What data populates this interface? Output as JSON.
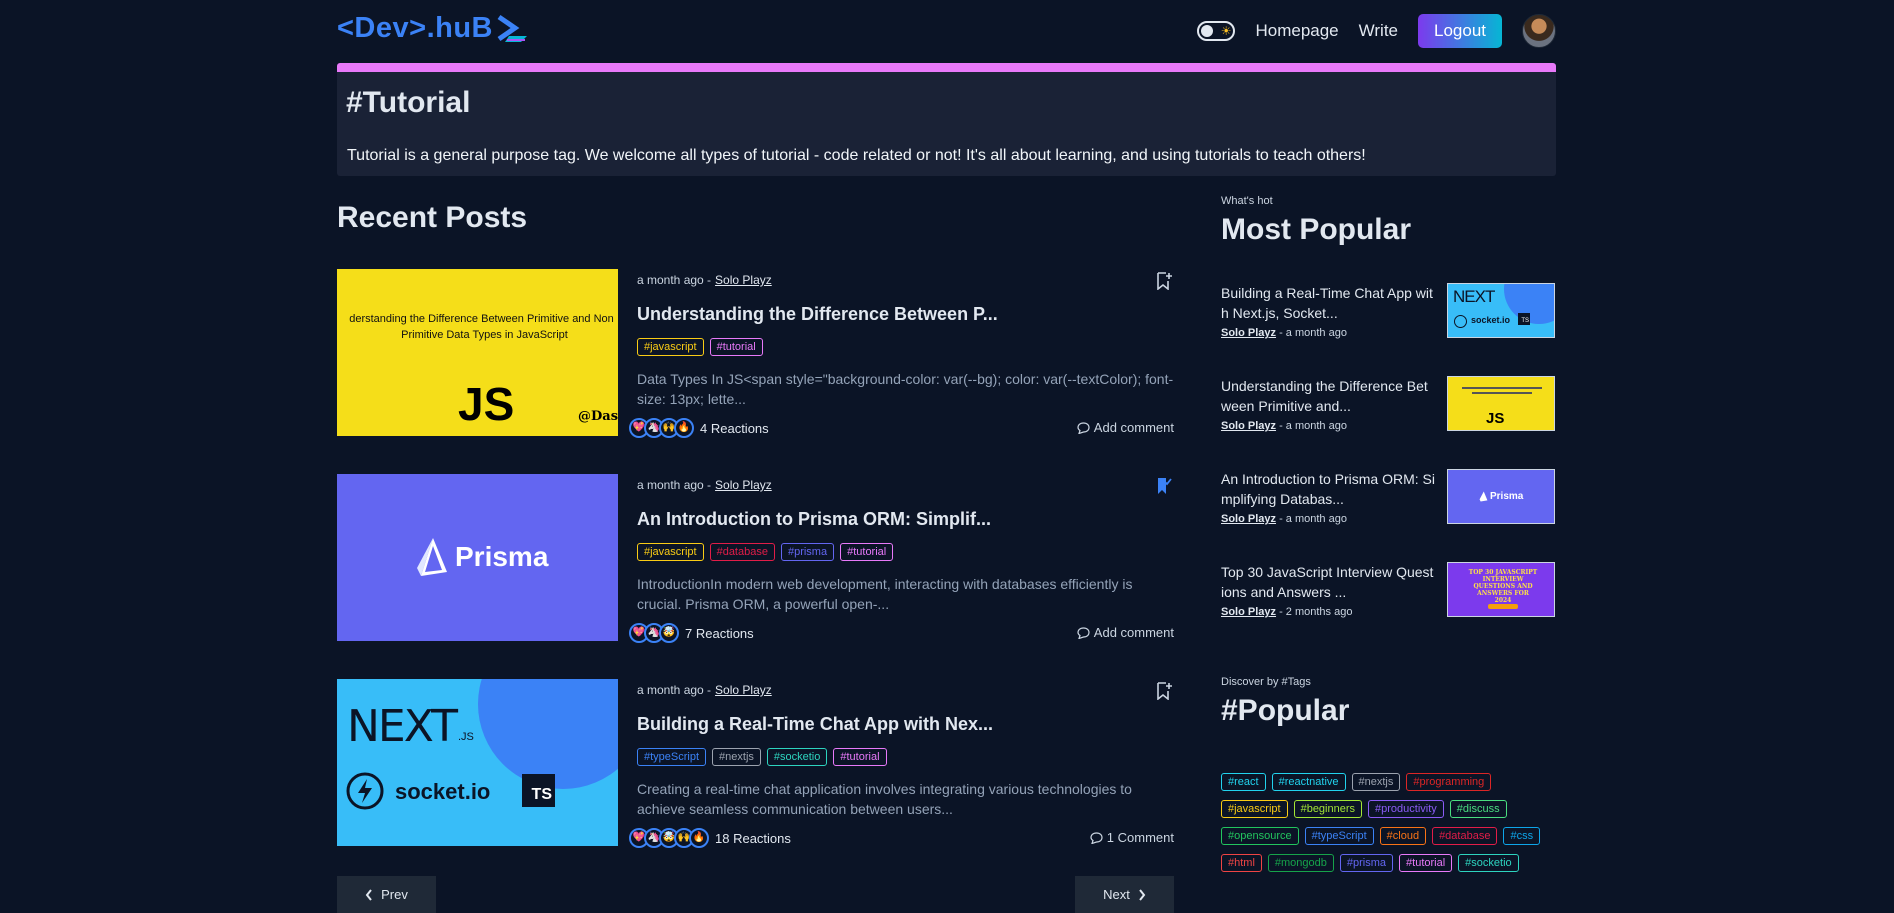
{
  "header": {
    "logo": "<Dev>.huB",
    "nav_home": "Homepage",
    "nav_write": "Write",
    "logout": "Logout"
  },
  "banner": {
    "title": "#Tutorial",
    "description": "Tutorial is a general purpose tag. We welcome all types of tutorial - code related or not! It's all about learning, and using tutorials to teach others!"
  },
  "recent": {
    "title": "Recent Posts",
    "posts": [
      {
        "time": "a month ago -",
        "author": "Solo Playz",
        "title": "Understanding the Difference Between P...",
        "tags": [
          "#javascript",
          "#tutorial"
        ],
        "excerpt": "Data Types In JS<span style=\"background-color: var(--bg); color: var(--textColor); font-size: 13px; lette...",
        "reactions": "4 Reactions",
        "comment": "Add comment",
        "bookmarked": false,
        "thumb": {
          "line1": "derstanding the Difference Between Primitive and Non",
          "line2": "Primitive Data Types in JavaScript",
          "big": "JS",
          "corner": "@Dasl"
        }
      },
      {
        "time": "a month ago -",
        "author": "Solo Playz",
        "title": "An Introduction to Prisma ORM: Simplif...",
        "tags": [
          "#javascript",
          "#database",
          "#prisma",
          "#tutorial"
        ],
        "excerpt": "IntroductionIn modern web development, interacting with databases efficiently is crucial. Prisma ORM, a powerful open-...",
        "reactions": "7 Reactions",
        "comment": "Add comment",
        "bookmarked": true,
        "thumb": {
          "brand": "Prisma"
        }
      },
      {
        "time": "a month ago -",
        "author": "Solo Playz",
        "title": "Building a Real-Time Chat App with Nex...",
        "tags": [
          "#typeScript",
          "#nextjs",
          "#socketio",
          "#tutorial"
        ],
        "excerpt": "Creating a real-time chat application involves integrating various technologies to achieve seamless communication between users...",
        "reactions": "18 Reactions",
        "comment": "1 Comment",
        "bookmarked": false,
        "thumb": {
          "next": "NEXT",
          "js": ".JS",
          "socket": "socket.io",
          "ts": "TS"
        }
      }
    ],
    "prev": "Prev",
    "next": "Next"
  },
  "sidebar": {
    "kicker": "What's hot",
    "title": "Most Popular",
    "items": [
      {
        "title": "Building a Real-Time Chat App wit h Next.js, Socket...",
        "author": "Solo Playz",
        "time": " - a month ago"
      },
      {
        "title": "Understanding the Difference Bet ween Primitive and...",
        "author": "Solo Playz",
        "time": " - a month ago"
      },
      {
        "title": "An Introduction to Prisma ORM: Si mplifying Databas...",
        "author": "Solo Playz",
        "time": " - a month ago"
      },
      {
        "title": "Top 30 JavaScript Interview Quest ions and Answers ...",
        "author": "Solo Playz",
        "time": " - 2 months ago"
      }
    ],
    "thumbs": {
      "next": "NEXT",
      "socket": "socket.io",
      "ts": "TS",
      "js": "JS",
      "prisma": "Prisma",
      "interview": "TOP 30 JAVASCRIPT INTERVIEW QUESTIONS AND ANSWERS FOR 2024"
    }
  },
  "tags": {
    "kicker": "Discover by #Tags",
    "title": "#Popular",
    "list": [
      {
        "label": "#react",
        "color": "#22d3ee"
      },
      {
        "label": "#reactnative",
        "color": "#22d3ee"
      },
      {
        "label": "#nextjs",
        "color": "#9ca3af"
      },
      {
        "label": "#programming",
        "color": "#dc2626"
      },
      {
        "label": "#javascript",
        "color": "#facc15"
      },
      {
        "label": "#beginners",
        "color": "#a3e635"
      },
      {
        "label": "#productivity",
        "color": "#8b5cf6"
      },
      {
        "label": "#discuss",
        "color": "#4ade80"
      },
      {
        "label": "#opensource",
        "color": "#22c55e"
      },
      {
        "label": "#typeScript",
        "color": "#3b82f6"
      },
      {
        "label": "#cloud",
        "color": "#f97316"
      },
      {
        "label": "#database",
        "color": "#e11d48"
      },
      {
        "label": "#css",
        "color": "#0ea5e9"
      },
      {
        "label": "#html",
        "color": "#ef4444"
      },
      {
        "label": "#mongodb",
        "color": "#16a34a"
      },
      {
        "label": "#prisma",
        "color": "#6366f1"
      },
      {
        "label": "#tutorial",
        "color": "#e879f9"
      },
      {
        "label": "#socketio",
        "color": "#2dd4bf"
      }
    ]
  },
  "tag_colors": {
    "#javascript": "#facc15",
    "#tutorial": "#e879f9",
    "#database": "#e11d48",
    "#prisma": "#6366f1",
    "#typeScript": "#3b82f6",
    "#nextjs": "#9ca3af",
    "#socketio": "#2dd4bf"
  }
}
